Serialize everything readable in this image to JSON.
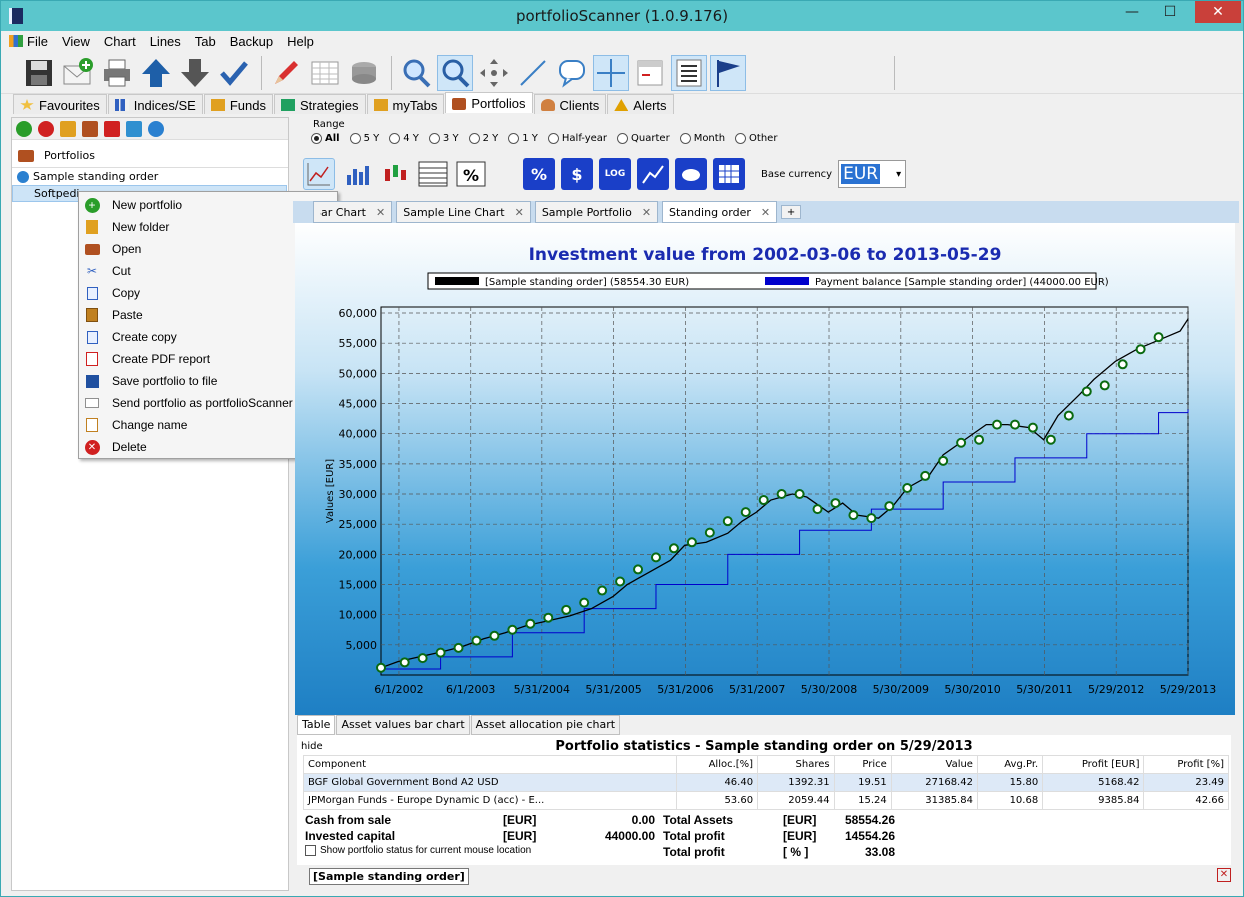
{
  "window": {
    "title": "portfolioScanner (1.0.9.176)",
    "minimize": "—",
    "maximize": "☐",
    "close": "✕"
  },
  "menu": [
    "File",
    "View",
    "Chart",
    "Lines",
    "Tab",
    "Backup",
    "Help"
  ],
  "nav_tabs": [
    {
      "label": "Favourites",
      "icon": "star-icon",
      "color": "#f0c040"
    },
    {
      "label": "Indices/SE",
      "icon": "chart-icon",
      "color": "#3060c0"
    },
    {
      "label": "Funds",
      "icon": "fund-icon",
      "color": "#e0a020"
    },
    {
      "label": "Strategies",
      "icon": "strategy-icon",
      "color": "#20a060"
    },
    {
      "label": "myTabs",
      "icon": "folder-icon",
      "color": "#e0a020"
    },
    {
      "label": "Portfolios",
      "icon": "wallet-icon",
      "color": "#b05020"
    },
    {
      "label": "Clients",
      "icon": "person-icon",
      "color": "#d08040"
    },
    {
      "label": "Alerts",
      "icon": "warning-icon",
      "color": "#e0a000"
    }
  ],
  "left": {
    "tree_title": "Portfolios",
    "items": [
      "Sample standing order",
      "Softpedia"
    ]
  },
  "context_menu": [
    {
      "label": "New portfolio",
      "icon": "plus-icon",
      "color": "#2a9d2a"
    },
    {
      "label": "New folder",
      "icon": "folder-icon",
      "color": "#e0a020"
    },
    {
      "label": "Open",
      "icon": "wallet-icon",
      "color": "#b05020"
    },
    {
      "label": "Cut",
      "icon": "scissors-icon",
      "color": "#3060c0"
    },
    {
      "label": "Copy",
      "icon": "copy-icon",
      "color": "#3060c0"
    },
    {
      "label": "Paste",
      "icon": "paste-icon",
      "color": "#c08020"
    },
    {
      "label": "Create copy",
      "icon": "duplicate-icon",
      "color": "#3060c0"
    },
    {
      "label": "Create PDF report",
      "icon": "pdf-icon",
      "color": "#d02020"
    },
    {
      "label": "Save portfolio to file",
      "icon": "save-icon",
      "color": "#2050a0"
    },
    {
      "label": "Send portfolio as portfolioScanner file",
      "icon": "mail-icon",
      "color": "#909090"
    },
    {
      "label": "Change name",
      "icon": "edit-icon",
      "color": "#c08020"
    },
    {
      "label": "Delete",
      "icon": "delete-icon",
      "color": "#d02020"
    }
  ],
  "range": {
    "label": "Range",
    "options": [
      "All",
      "5 Y",
      "4 Y",
      "3 Y",
      "2 Y",
      "1 Y",
      "Half-year",
      "Quarter",
      "Month",
      "Other"
    ],
    "selected": "All"
  },
  "base_currency": {
    "label": "Base currency",
    "value": "EUR"
  },
  "doc_tabs": [
    "Sample Bar Chart",
    "Sample Line Chart",
    "Sample Portfolio",
    "Standing order"
  ],
  "active_doc_tab": "Standing order",
  "chart_data": {
    "type": "line",
    "title": "Investment value from 2002-03-06 to 2013-05-29",
    "ylabel": "Values [EUR]",
    "xlabel": "",
    "ylim": [
      0,
      61000
    ],
    "yticks": [
      "60,000",
      "55,000",
      "50,000",
      "45,000",
      "40,000",
      "35,000",
      "30,000",
      "25,000",
      "20,000",
      "15,000",
      "10,000",
      "5,000"
    ],
    "xticks": [
      "6/1/2002",
      "6/1/2003",
      "5/31/2004",
      "5/31/2005",
      "5/31/2006",
      "5/31/2007",
      "5/30/2008",
      "5/30/2009",
      "5/30/2010",
      "5/30/2011",
      "5/29/2012",
      "5/29/2013"
    ],
    "legend_placement": "top",
    "grid": true,
    "series": [
      {
        "name": "[Sample standing order] (58554.30 EUR)",
        "color": "#000000",
        "x": [
          2002.17,
          2002.4,
          2002.7,
          2003.0,
          2003.3,
          2003.6,
          2003.9,
          2004.2,
          2004.5,
          2004.8,
          2005.1,
          2005.4,
          2005.6,
          2005.9,
          2006.2,
          2006.4,
          2006.7,
          2007.0,
          2007.2,
          2007.4,
          2007.6,
          2007.9,
          2008.1,
          2008.4,
          2008.6,
          2008.8,
          2009.1,
          2009.3,
          2009.5,
          2009.8,
          2010.0,
          2010.3,
          2010.6,
          2010.9,
          2011.2,
          2011.4,
          2011.6,
          2011.9,
          2012.1,
          2012.4,
          2012.7,
          2013.0,
          2013.3,
          2013.41
        ],
        "y": [
          1200,
          2200,
          3000,
          3800,
          4700,
          6000,
          7000,
          8200,
          9000,
          9800,
          11000,
          13000,
          15000,
          17000,
          19000,
          21500,
          22000,
          23500,
          25500,
          27000,
          29000,
          30000,
          29500,
          27000,
          28500,
          26500,
          26000,
          28000,
          31000,
          33000,
          36500,
          39000,
          41500,
          41500,
          41000,
          39000,
          43000,
          46500,
          49000,
          52000,
          54000,
          55500,
          57000,
          59000
        ]
      },
      {
        "name": "Payment balance [Sample standing order] (44000.00 EUR)",
        "color": "#0000cc",
        "x": [
          2002.17,
          2003.0,
          2004.0,
          2005.0,
          2006.0,
          2007.0,
          2008.0,
          2009.0,
          2010.0,
          2011.0,
          2012.0,
          2013.0,
          2013.41
        ],
        "y": [
          1000,
          3000,
          7000,
          11000,
          15000,
          20000,
          24000,
          27500,
          32000,
          36000,
          40000,
          43500,
          44000
        ]
      }
    ],
    "markers": {
      "x": [
        2002.17,
        2002.5,
        2002.75,
        2003.0,
        2003.25,
        2003.5,
        2003.75,
        2004.0,
        2004.25,
        2004.5,
        2004.75,
        2005.0,
        2005.25,
        2005.5,
        2005.75,
        2006.0,
        2006.25,
        2006.5,
        2006.75,
        2007.0,
        2007.25,
        2007.5,
        2007.75,
        2008.0,
        2008.25,
        2008.5,
        2008.75,
        2009.0,
        2009.25,
        2009.5,
        2009.75,
        2010.0,
        2010.25,
        2010.5,
        2010.75,
        2011.0,
        2011.25,
        2011.5,
        2011.75,
        2012.0,
        2012.25,
        2012.5,
        2012.75,
        2013.0
      ],
      "y": [
        1200,
        2100,
        2800,
        3700,
        4500,
        5700,
        6500,
        7500,
        8500,
        9500,
        10800,
        12000,
        14000,
        15500,
        17500,
        19500,
        21000,
        22000,
        23600,
        25500,
        27000,
        29000,
        30000,
        30000,
        27500,
        28500,
        26500,
        26000,
        28000,
        31000,
        33000,
        35500,
        38500,
        39000,
        41500,
        41500,
        41000,
        39000,
        43000,
        47000,
        48000,
        51500,
        54000,
        56000
      ]
    }
  },
  "bottom_tabs": [
    "Table",
    "Asset values bar chart",
    "Asset allocation pie chart"
  ],
  "stats": {
    "hide_label": "hide",
    "title": "Portfolio statistics - Sample standing order on 5/29/2013",
    "columns": [
      "Component",
      "Alloc.[%]",
      "Shares",
      "Price",
      "Value",
      "Avg.Pr.",
      "Profit [EUR]",
      "Profit [%]"
    ],
    "rows": [
      [
        "BGF Global Government Bond A2 USD",
        "46.40",
        "1392.31",
        "19.51",
        "27168.42",
        "15.80",
        "5168.42",
        "23.49"
      ],
      [
        "JPMorgan Funds - Europe Dynamic D (acc) - E...",
        "53.60",
        "2059.44",
        "15.24",
        "31385.84",
        "10.68",
        "9385.84",
        "42.66"
      ]
    ],
    "summary": {
      "cash_label": "Cash from sale",
      "cash_unit": "[EUR]",
      "cash_value": "0.00",
      "invested_label": "Invested capital",
      "invested_unit": "[EUR]",
      "invested_value": "44000.00",
      "total_assets_label": "Total Assets",
      "total_assets_unit": "[EUR]",
      "total_assets_value": "58554.26",
      "total_profit_label": "Total profit",
      "total_profit_unit": "[EUR]",
      "total_profit_value": "14554.26",
      "total_profit_pct_label": "Total profit",
      "total_profit_pct_unit": "[ % ]",
      "total_profit_pct_value": "33.08"
    },
    "checkbox_label": "Show portfolio status for current mouse location"
  },
  "status": {
    "portfolio_button": "[Sample standing order]"
  }
}
